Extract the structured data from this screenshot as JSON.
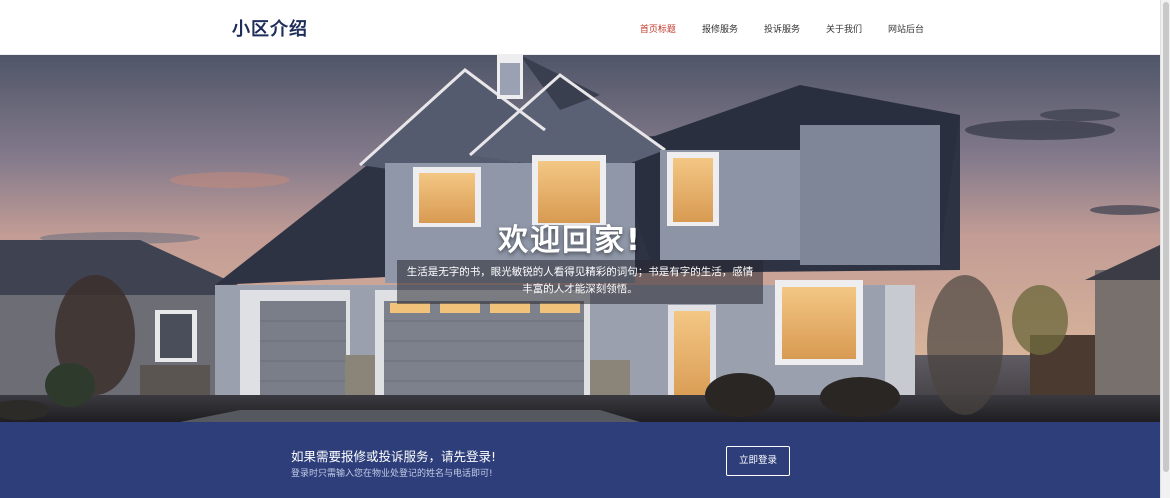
{
  "header": {
    "logo": "小区介绍",
    "nav": [
      {
        "label": "首页标题",
        "active": true
      },
      {
        "label": "报修服务",
        "active": false
      },
      {
        "label": "投诉服务",
        "active": false
      },
      {
        "label": "关于我们",
        "active": false
      },
      {
        "label": "网站后台",
        "active": false
      }
    ]
  },
  "hero": {
    "title": "欢迎回家!",
    "desc_line1": "生活是无字的书，眼光敏锐的人看得见精彩的词句；书是有字的生活，感情",
    "desc_line2": "丰富的人才能深刻领悟。"
  },
  "banner": {
    "title": "如果需要报修或投诉服务，请先登录!",
    "subtitle": "登录时只需输入您在物业处登记的姓名与电话即可!",
    "button": "立即登录"
  },
  "colors": {
    "brand_navy": "#2d3e7a",
    "logo": "#1f2d5a",
    "nav_active": "#c0392b"
  }
}
